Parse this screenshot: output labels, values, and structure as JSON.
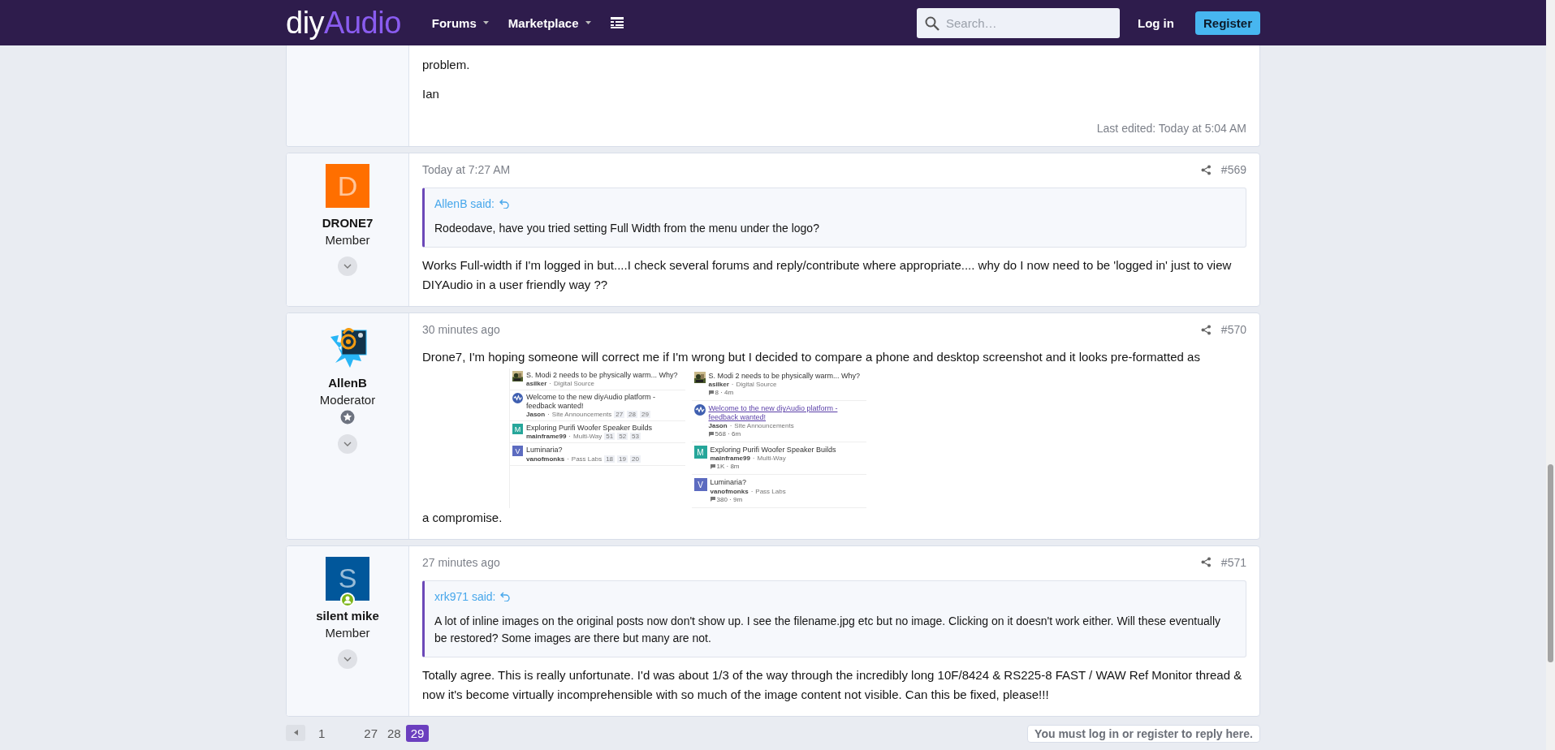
{
  "header": {
    "logo": [
      "diy",
      "Audio"
    ],
    "nav": [
      "Forums",
      "Marketplace"
    ],
    "search": {
      "placeholder": "Search…"
    },
    "login": "Log in",
    "register": "Register"
  },
  "posts": [
    {
      "blocks": [
        {
          "kind": "text",
          "text": "problem."
        },
        {
          "kind": "text",
          "text": "Ian"
        }
      ],
      "last_edited": "Last edited: Today at 5:04 AM"
    },
    {
      "user": {
        "name": "DRONE7",
        "title": "Member",
        "avatar": {
          "kind": "letter",
          "letter": "D",
          "color": "#ff6f00"
        },
        "staff": false,
        "online": false
      },
      "time": "Today at 7:27 AM",
      "number": "#569",
      "quote": {
        "author": "AllenB said:",
        "text": "Rodeodave, have you tried setting Full Width from the menu under the logo?"
      },
      "blocks": [
        {
          "kind": "text",
          "text": "Works Full-width if I'm logged in but....I check several forums and reply/contribute where appropriate.... why do I now need to be 'logged in' just to view DIYAudio in a user friendly way ??"
        }
      ]
    },
    {
      "user": {
        "name": "AllenB",
        "title": "Moderator",
        "staff": true,
        "online": false
      },
      "time": "30 minutes ago",
      "number": "#570",
      "blocks": [
        {
          "kind": "text",
          "text": "Drone7, I'm hoping someone will correct me if I'm wrong but I decided to compare a phone and desktop screenshot and it looks pre-formatted as"
        },
        {
          "kind": "screenshot",
          "panels": [
            {
              "kind": "compact",
              "items": [
                {
                  "title": "S. Modi 2 needs to be physically warm... Why?",
                  "author": "asilker",
                  "sep": "·",
                  "forum": "Digital Source"
                },
                {
                  "avatar": {
                    "kind": "logo"
                  },
                  "title": "Welcome to the new diyAudio platform - feedback wanted!",
                  "author": "Jason",
                  "sep": "·",
                  "forum": "Site Announcements",
                  "pages": [
                    "27",
                    "28",
                    "29"
                  ]
                },
                {
                  "avatar": {
                    "kind": "letter",
                    "letter": "M",
                    "color": "#26a69a"
                  },
                  "title": "Exploring Purifi Woofer Speaker Builds",
                  "author": "mainframe99",
                  "sep": "·",
                  "forum": "Multi-Way",
                  "pages": [
                    "51",
                    "52",
                    "53"
                  ]
                },
                {
                  "avatar": {
                    "kind": "letter",
                    "letter": "V",
                    "color": "#5c6bc0"
                  },
                  "title": "Luminaria?",
                  "author": "vanofmonks",
                  "sep": "·",
                  "forum": "Pass Labs",
                  "pages": [
                    "18",
                    "19",
                    "20"
                  ]
                }
              ]
            },
            {
              "kind": "expanded",
              "items": [
                {
                  "title": "S. Modi 2 needs to be physically warm... Why?",
                  "highlighted": false,
                  "author": "asilker",
                  "sep": "·",
                  "forum": "Digital Source",
                  "stats": "8 · 4m"
                },
                {
                  "avatar": {
                    "kind": "logo"
                  },
                  "title": "Welcome to the new diyAudio platform - feedback wanted!",
                  "highlighted": true,
                  "author": "Jason",
                  "sep": "·",
                  "forum": "Site Announcements",
                  "stats": "568 · 6m"
                },
                {
                  "avatar": {
                    "kind": "letter",
                    "letter": "M",
                    "color": "#26a69a"
                  },
                  "title": "Exploring Purifi Woofer Speaker Builds",
                  "highlighted": false,
                  "author": "mainframe99",
                  "sep": "·",
                  "forum": "Multi-Way",
                  "stats": "1K · 8m"
                },
                {
                  "avatar": {
                    "kind": "letter",
                    "letter": "V",
                    "color": "#5c6bc0"
                  },
                  "title": "Luminaria?",
                  "highlighted": false,
                  "author": "vanofmonks",
                  "sep": "·",
                  "forum": "Pass Labs",
                  "stats": "380 · 9m"
                }
              ]
            }
          ]
        },
        {
          "kind": "text",
          "text": "a compromise."
        }
      ]
    },
    {
      "user": {
        "name": "silent mike",
        "title": "Member",
        "avatar": {
          "kind": "letter",
          "letter": "S",
          "color": "#01579b"
        },
        "staff": false,
        "online": true
      },
      "time": "27 minutes ago",
      "number": "#571",
      "quote": {
        "author": "xrk971 said:",
        "text": "A lot of inline images on the original posts now don't show up. I see the filename.jpg etc but no image. Clicking on it doesn't work either. Will these eventually be restored? Some images are there but many are not."
      },
      "blocks": [
        {
          "kind": "text",
          "text": "Totally agree. This is really unfortunate. I'd was about 1/3 of the way through the incredibly long 10F/8424 & RS225-8 FAST / WAW Ref Monitor thread & now it's become virtually incomprehensible with so much of the image content not visible. Can this be fixed, please!!!"
        }
      ]
    }
  ],
  "pagination": {
    "pages": [
      {
        "label": "1",
        "selected": false
      },
      {
        "label": "27",
        "selected": false
      },
      {
        "label": "28",
        "selected": false
      },
      {
        "label": "29",
        "selected": true
      }
    ]
  },
  "reply_notice": "You must log in or register to reply here."
}
